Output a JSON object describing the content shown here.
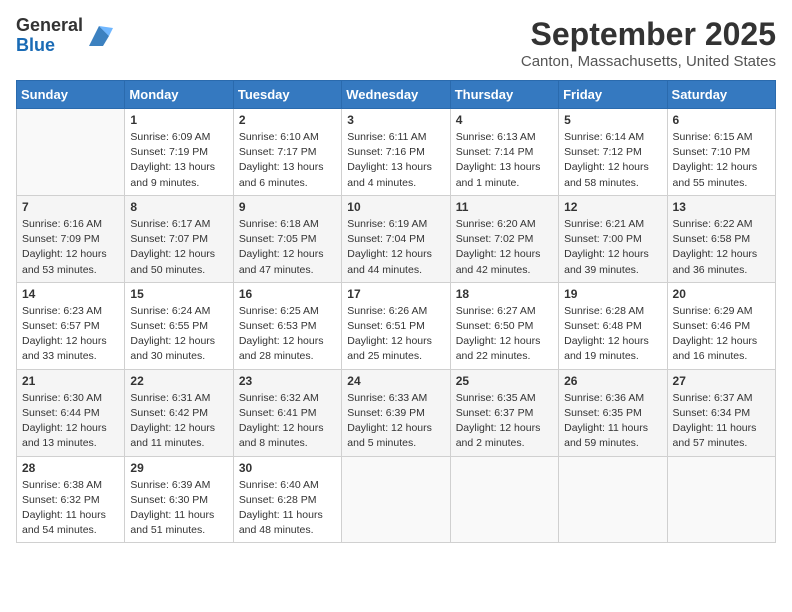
{
  "header": {
    "logo_line1": "General",
    "logo_line2": "Blue",
    "month_title": "September 2025",
    "location": "Canton, Massachusetts, United States"
  },
  "days_of_week": [
    "Sunday",
    "Monday",
    "Tuesday",
    "Wednesday",
    "Thursday",
    "Friday",
    "Saturday"
  ],
  "weeks": [
    [
      {
        "day": "",
        "info": ""
      },
      {
        "day": "1",
        "info": "Sunrise: 6:09 AM\nSunset: 7:19 PM\nDaylight: 13 hours\nand 9 minutes."
      },
      {
        "day": "2",
        "info": "Sunrise: 6:10 AM\nSunset: 7:17 PM\nDaylight: 13 hours\nand 6 minutes."
      },
      {
        "day": "3",
        "info": "Sunrise: 6:11 AM\nSunset: 7:16 PM\nDaylight: 13 hours\nand 4 minutes."
      },
      {
        "day": "4",
        "info": "Sunrise: 6:13 AM\nSunset: 7:14 PM\nDaylight: 13 hours\nand 1 minute."
      },
      {
        "day": "5",
        "info": "Sunrise: 6:14 AM\nSunset: 7:12 PM\nDaylight: 12 hours\nand 58 minutes."
      },
      {
        "day": "6",
        "info": "Sunrise: 6:15 AM\nSunset: 7:10 PM\nDaylight: 12 hours\nand 55 minutes."
      }
    ],
    [
      {
        "day": "7",
        "info": "Sunrise: 6:16 AM\nSunset: 7:09 PM\nDaylight: 12 hours\nand 53 minutes."
      },
      {
        "day": "8",
        "info": "Sunrise: 6:17 AM\nSunset: 7:07 PM\nDaylight: 12 hours\nand 50 minutes."
      },
      {
        "day": "9",
        "info": "Sunrise: 6:18 AM\nSunset: 7:05 PM\nDaylight: 12 hours\nand 47 minutes."
      },
      {
        "day": "10",
        "info": "Sunrise: 6:19 AM\nSunset: 7:04 PM\nDaylight: 12 hours\nand 44 minutes."
      },
      {
        "day": "11",
        "info": "Sunrise: 6:20 AM\nSunset: 7:02 PM\nDaylight: 12 hours\nand 42 minutes."
      },
      {
        "day": "12",
        "info": "Sunrise: 6:21 AM\nSunset: 7:00 PM\nDaylight: 12 hours\nand 39 minutes."
      },
      {
        "day": "13",
        "info": "Sunrise: 6:22 AM\nSunset: 6:58 PM\nDaylight: 12 hours\nand 36 minutes."
      }
    ],
    [
      {
        "day": "14",
        "info": "Sunrise: 6:23 AM\nSunset: 6:57 PM\nDaylight: 12 hours\nand 33 minutes."
      },
      {
        "day": "15",
        "info": "Sunrise: 6:24 AM\nSunset: 6:55 PM\nDaylight: 12 hours\nand 30 minutes."
      },
      {
        "day": "16",
        "info": "Sunrise: 6:25 AM\nSunset: 6:53 PM\nDaylight: 12 hours\nand 28 minutes."
      },
      {
        "day": "17",
        "info": "Sunrise: 6:26 AM\nSunset: 6:51 PM\nDaylight: 12 hours\nand 25 minutes."
      },
      {
        "day": "18",
        "info": "Sunrise: 6:27 AM\nSunset: 6:50 PM\nDaylight: 12 hours\nand 22 minutes."
      },
      {
        "day": "19",
        "info": "Sunrise: 6:28 AM\nSunset: 6:48 PM\nDaylight: 12 hours\nand 19 minutes."
      },
      {
        "day": "20",
        "info": "Sunrise: 6:29 AM\nSunset: 6:46 PM\nDaylight: 12 hours\nand 16 minutes."
      }
    ],
    [
      {
        "day": "21",
        "info": "Sunrise: 6:30 AM\nSunset: 6:44 PM\nDaylight: 12 hours\nand 13 minutes."
      },
      {
        "day": "22",
        "info": "Sunrise: 6:31 AM\nSunset: 6:42 PM\nDaylight: 12 hours\nand 11 minutes."
      },
      {
        "day": "23",
        "info": "Sunrise: 6:32 AM\nSunset: 6:41 PM\nDaylight: 12 hours\nand 8 minutes."
      },
      {
        "day": "24",
        "info": "Sunrise: 6:33 AM\nSunset: 6:39 PM\nDaylight: 12 hours\nand 5 minutes."
      },
      {
        "day": "25",
        "info": "Sunrise: 6:35 AM\nSunset: 6:37 PM\nDaylight: 12 hours\nand 2 minutes."
      },
      {
        "day": "26",
        "info": "Sunrise: 6:36 AM\nSunset: 6:35 PM\nDaylight: 11 hours\nand 59 minutes."
      },
      {
        "day": "27",
        "info": "Sunrise: 6:37 AM\nSunset: 6:34 PM\nDaylight: 11 hours\nand 57 minutes."
      }
    ],
    [
      {
        "day": "28",
        "info": "Sunrise: 6:38 AM\nSunset: 6:32 PM\nDaylight: 11 hours\nand 54 minutes."
      },
      {
        "day": "29",
        "info": "Sunrise: 6:39 AM\nSunset: 6:30 PM\nDaylight: 11 hours\nand 51 minutes."
      },
      {
        "day": "30",
        "info": "Sunrise: 6:40 AM\nSunset: 6:28 PM\nDaylight: 11 hours\nand 48 minutes."
      },
      {
        "day": "",
        "info": ""
      },
      {
        "day": "",
        "info": ""
      },
      {
        "day": "",
        "info": ""
      },
      {
        "day": "",
        "info": ""
      }
    ]
  ]
}
